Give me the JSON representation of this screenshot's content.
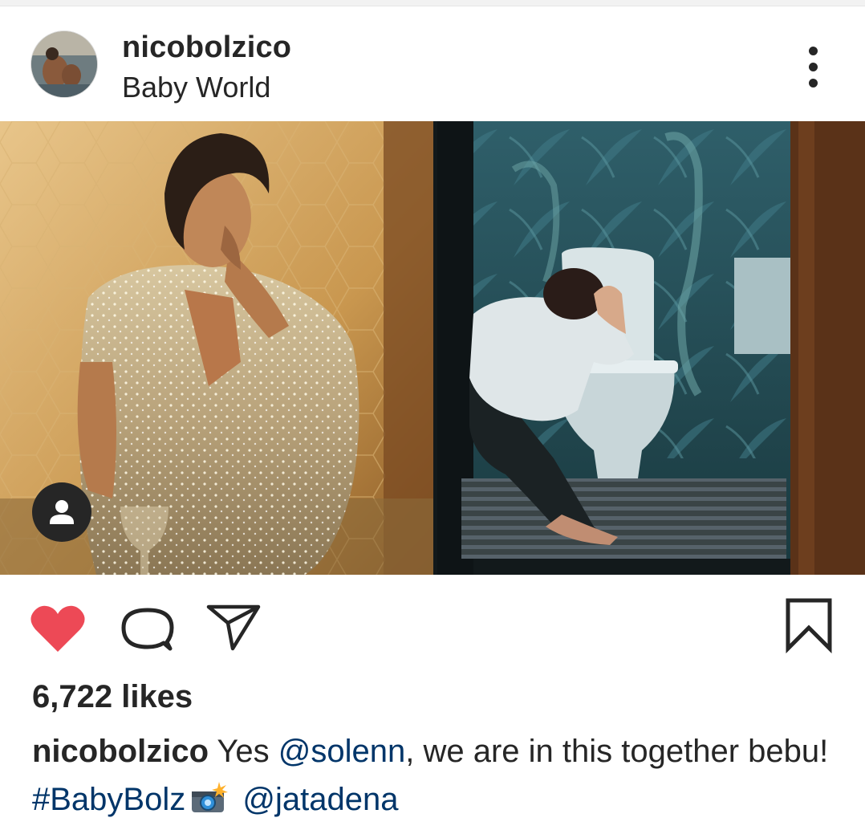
{
  "post": {
    "username": "nicobolzico",
    "location": "Baby World"
  },
  "icons": {
    "more": "more-vertical-icon",
    "like": "heart-icon",
    "comment": "comment-icon",
    "share": "paper-plane-icon",
    "save": "bookmark-icon",
    "tag": "person-icon",
    "camera": "camera-flash-emoji"
  },
  "colors": {
    "like": "#ed4956",
    "link": "#003569",
    "text": "#262626"
  },
  "engagement": {
    "likes": "6,722 likes"
  },
  "caption": {
    "username": "nicobolzico",
    "part1": "Yes ",
    "mention1": "@solenn",
    "part2": ", we are in this together bebu! ",
    "hashtag": "#BabyBolz",
    "part3": " ",
    "mention2": "@jatadena"
  }
}
